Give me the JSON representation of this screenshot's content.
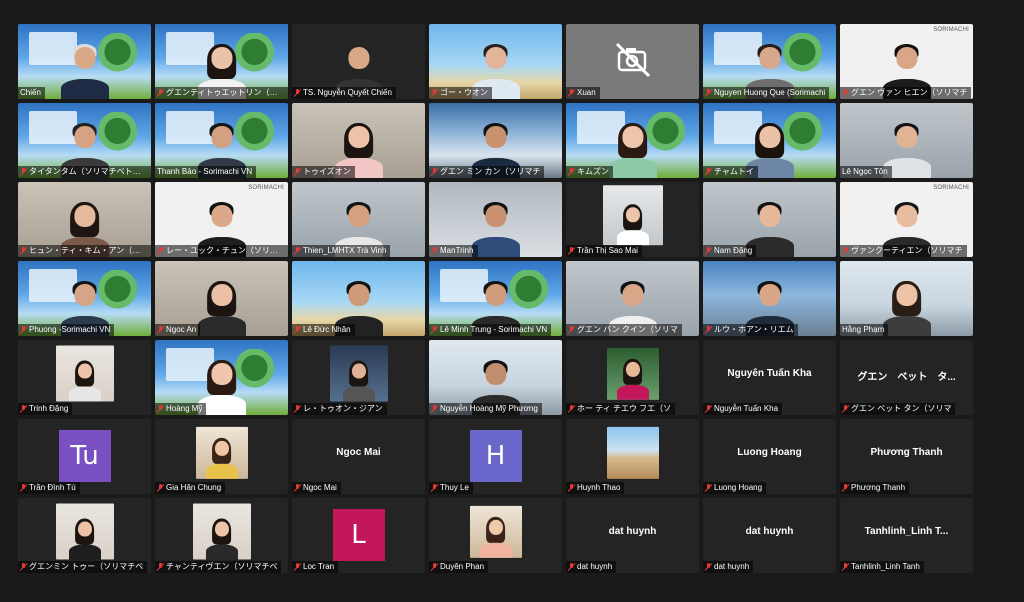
{
  "app": {
    "name": "Zoom Meeting",
    "view": "Gallery View"
  },
  "colors": {
    "background": "#1a1a1a",
    "tile": "#242424",
    "active_speaker_border": "#d6c84a",
    "muted_mic": "#e53935",
    "label_bg": "rgba(0,0,0,0.55)"
  },
  "participants": [
    {
      "label": "Chiến",
      "video": "banner",
      "skin": "#d9a987",
      "hair": "#dcdcdc",
      "shirt": "#1f2a44",
      "muted": false
    },
    {
      "label": "グエンティトゥエットリン（ソリマチ",
      "video": "banner",
      "skin": "#eac2a6",
      "hair": "#1b1410",
      "shirt": "#f2f2f2",
      "longhair": true,
      "active": true,
      "muted": true
    },
    {
      "label": "TS. Nguyễn Quyết Chiến",
      "video": "dark",
      "muted": true
    },
    {
      "label": "ゴー・ウオン",
      "video": "beach",
      "skin": "#e2b59a",
      "hair": "#2a1f1a",
      "shirt": "#dfe9f2",
      "muted": true
    },
    {
      "label": "Xuan",
      "video": "cam-off",
      "muted": true
    },
    {
      "label": "Nguyen Huong Que (Sorimachi",
      "video": "banner",
      "skin": "#d8a88c",
      "hair": "#2a1d17",
      "shirt": "#6e6e6e",
      "muted": true
    },
    {
      "label": "グエン ヴァン ヒエン（ソリマチ",
      "video": "white",
      "skin": "#d9a788",
      "hair": "#141010",
      "shirt": "#1b1b1b",
      "logo": "SORIMACHI",
      "muted": true
    },
    {
      "label": "タイタンタム（ソリマチベトナム",
      "video": "banner",
      "skin": "#d6a283",
      "hair": "#222",
      "shirt": "#3a3a3a",
      "muted": true
    },
    {
      "label": "Thanh Bảo - Sorimachi VN",
      "video": "banner",
      "skin": "#d3a082",
      "hair": "#151515",
      "shirt": "#303a48",
      "muted": false
    },
    {
      "label": "トゥイズオン",
      "video": "room",
      "skin": "#efc3a8",
      "hair": "#1c1410",
      "shirt": "#f3c6c6",
      "longhair": true,
      "muted": true
    },
    {
      "label": "グエン ミン カン（ソリマチ",
      "video": "sky",
      "skin": "#c9926f",
      "hair": "#131313",
      "shirt": "#1a2a3f",
      "muted": true
    },
    {
      "label": "キムズン",
      "video": "banner",
      "skin": "#efc5aa",
      "hair": "#2a1a12",
      "shirt": "#8cc9a6",
      "longhair": true,
      "muted": true
    },
    {
      "label": "チャムトイ",
      "video": "banner",
      "skin": "#ecc2a6",
      "hair": "#1b120e",
      "shirt": "#6d86a6",
      "longhair": true,
      "muted": true
    },
    {
      "label": "Lê Ngọc Tôn",
      "video": "wall",
      "skin": "#e0b394",
      "hair": "#121212",
      "shirt": "#dfe2e6",
      "muted": false
    },
    {
      "label": "ヒュン・ティ・キム・アン（ソリ",
      "video": "room",
      "skin": "#e6b89c",
      "hair": "#1f1512",
      "shirt": "#7a5a4a",
      "longhair": true,
      "muted": true
    },
    {
      "label": "レー・ユック・チュン（ソリマチ",
      "video": "white",
      "skin": "#d9a98a",
      "hair": "#121212",
      "shirt": "#1e1e1e",
      "logo": "SORIMACHI",
      "muted": true
    },
    {
      "label": "Thien_LMHTX Trà Vinh",
      "video": "wall",
      "skin": "#d4a080",
      "hair": "#141414",
      "shirt": "#e8e8e8",
      "muted": true
    },
    {
      "label": "ManTrinh",
      "video": "office",
      "skin": "#c8916f",
      "hair": "#111",
      "shirt": "#2d4c7a",
      "muted": true
    },
    {
      "label": "Trần Thị Sao Mai",
      "video": "dark",
      "thumb": "tall",
      "skin": "#eec4a9",
      "hair": "#1c1410",
      "shirt": "#ffffff",
      "longhair": true,
      "muted": true
    },
    {
      "label": "Nam Đặng",
      "video": "wall",
      "skin": "#e5b89a",
      "hair": "#141414",
      "shirt": "#2b2b2b",
      "muted": true
    },
    {
      "label": "ヴァンクーティエン（ソリマチ",
      "video": "white",
      "skin": "#e8bc9f",
      "hair": "#161616",
      "shirt": "#2a2a2a",
      "logo": "SORIMACHI",
      "muted": true
    },
    {
      "label": "Phuong -Sorimachi VN",
      "video": "banner",
      "skin": "#d6a587",
      "hair": "#141414",
      "shirt": "#2c3a4e",
      "muted": true
    },
    {
      "label": "Ngoc An",
      "video": "room",
      "skin": "#ecc0a4",
      "hair": "#1c1410",
      "shirt": "#2b2b2b",
      "longhair": true,
      "muted": true
    },
    {
      "label": "Lê Đức Nhân",
      "video": "beach",
      "skin": "#cf9a7a",
      "hair": "#121212",
      "shirt": "#222",
      "muted": true
    },
    {
      "label": "Lê Minh Trung - Sorimachi VN",
      "video": "banner",
      "skin": "#d09c7c",
      "hair": "#141414",
      "shirt": "#2a2a2a",
      "muted": true
    },
    {
      "label": "グエン バン クイン（ソリマ",
      "video": "wall",
      "skin": "#d8a788",
      "hair": "#121212",
      "shirt": "#efefef",
      "muted": true
    },
    {
      "label": "ルウ・ホアン・リエム",
      "video": "city",
      "skin": "#d8a586",
      "hair": "#121212",
      "shirt": "#1f2b3a",
      "muted": true
    },
    {
      "label": "Hằng Phạm",
      "video": "window",
      "skin": "#edc3a7",
      "hair": "#2a1d15",
      "shirt": "#3d3d3d",
      "longhair": true,
      "muted": false
    },
    {
      "label": "Trinh Đặng",
      "video": "dark",
      "thumb": "portrait",
      "skin": "#eec3a7",
      "hair": "#1c1410",
      "shirt": "#e6e6e6",
      "longhair": true,
      "muted": true
    },
    {
      "label": "Hoàng Mỹ",
      "video": "banner",
      "skin": "#efc6ab",
      "hair": "#2a1a12",
      "shirt": "#ffffff",
      "longhair": true,
      "muted": true
    },
    {
      "label": "レ・トゥオン・ジアン",
      "video": "dark",
      "thumb": "stage",
      "skin": "#e1b195",
      "hair": "#1c1410",
      "shirt": "#555",
      "longhair": true,
      "muted": true
    },
    {
      "label": "Nguyễn Hoàng Mỹ Phương",
      "video": "window",
      "skin": "#c28e70",
      "hair": "#111",
      "shirt": "#2a2a2a",
      "muted": true
    },
    {
      "label": "ホー ティ チエウ フエ（ソ",
      "video": "dark",
      "thumb": "window",
      "skin": "#e8b998",
      "hair": "#1c1410",
      "shirt": "#c2185b",
      "longhair": true,
      "muted": true
    },
    {
      "label": "Nguyễn Tuấn Kha",
      "video": "name",
      "display_name": "Nguyễn Tuấn Kha",
      "muted": true
    },
    {
      "label": "グエン ベット タン（ソリマ",
      "video": "name",
      "display_name": "グエン　ベット　タ...",
      "muted": true
    },
    {
      "label": "Trần Đình Tú",
      "video": "initial",
      "initial": "Tu",
      "initial_color": "#7a4fc2",
      "muted": true
    },
    {
      "label": "Gia Hân Chung",
      "video": "dark",
      "thumb": "small",
      "skin": "#f0c6a6",
      "hair": "#3a2418",
      "shirt": "#e8c24a",
      "longhair": true,
      "muted": true
    },
    {
      "label": "Ngoc Mai",
      "video": "name",
      "display_name": "Ngoc Mai",
      "muted": true
    },
    {
      "label": "Thuy Le",
      "video": "initial",
      "initial": "H",
      "initial_color": "#6b66c9",
      "muted": true
    },
    {
      "label": "Huynh Thao",
      "video": "dark",
      "thumb": "desert",
      "muted": true
    },
    {
      "label": "Luong Hoang",
      "video": "name",
      "display_name": "Luong Hoang",
      "muted": true
    },
    {
      "label": "Phương Thanh",
      "video": "name",
      "display_name": "Phương Thanh",
      "muted": true
    },
    {
      "label": "グエンミン トゥー（ソリマチベ",
      "video": "dark",
      "thumb": "portrait",
      "skin": "#eec2a6",
      "hair": "#1c1410",
      "shirt": "#1e1e1e",
      "longhair": true,
      "muted": true
    },
    {
      "label": "チャンティヴエン（ソリマチベ",
      "video": "dark",
      "thumb": "portrait",
      "skin": "#eec4a8",
      "hair": "#1c1410",
      "shirt": "#2a2a2a",
      "longhair": true,
      "muted": true
    },
    {
      "label": "Loc Tran",
      "video": "initial",
      "initial": "L",
      "initial_color": "#c2185b",
      "muted": true
    },
    {
      "label": "Duyên Phan",
      "video": "dark",
      "thumb": "small",
      "skin": "#f0c8ab",
      "hair": "#3a2418",
      "shirt": "#efb3a0",
      "longhair": true,
      "muted": true
    },
    {
      "label": "dat huynh",
      "video": "name",
      "display_name": "dat huynh",
      "muted": true
    },
    {
      "label": "dat huynh",
      "video": "name",
      "display_name": "dat huynh",
      "muted": true
    },
    {
      "label": "Tanhlinh_Linh Tanh",
      "video": "name",
      "display_name": "Tanhlinh_Linh T...",
      "muted": true
    }
  ]
}
